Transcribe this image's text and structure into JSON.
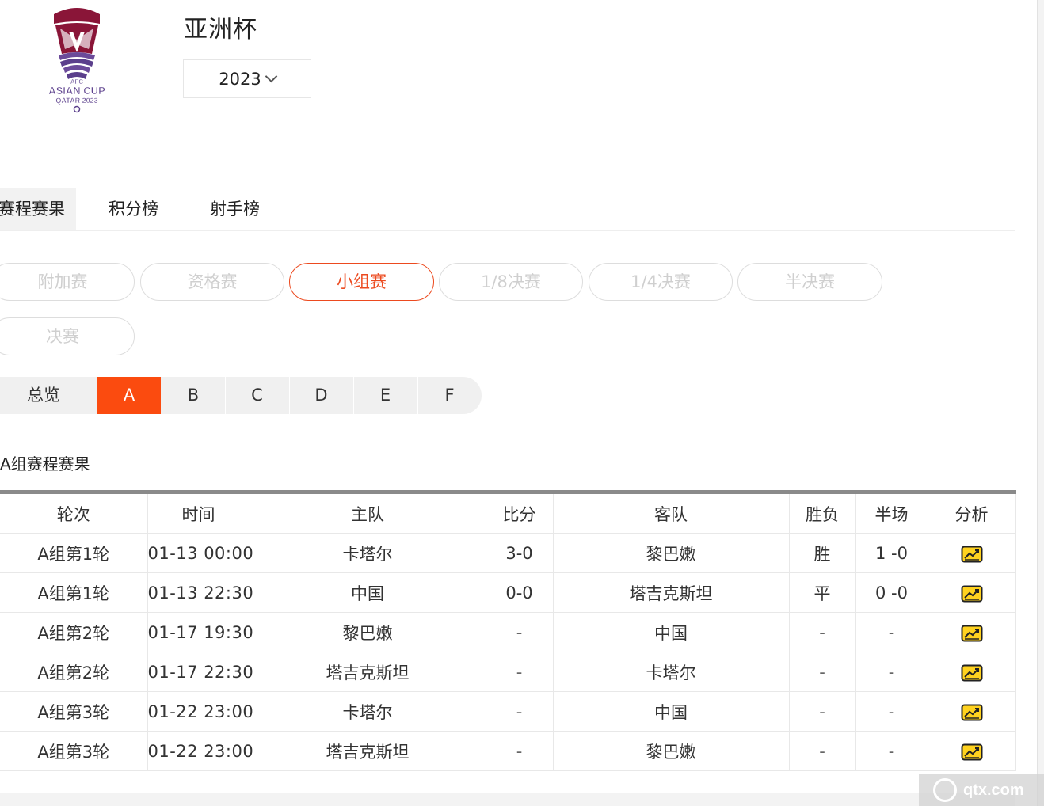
{
  "header": {
    "title": "亚洲杯",
    "season": "2023",
    "logo": {
      "line1": "AFC",
      "line2": "ASIAN CUP",
      "line3": "QATAR 2023",
      "colors": {
        "maroon": "#8a1538",
        "purple": "#5b3f8c",
        "white": "#ffffff"
      }
    }
  },
  "tabs": [
    "赛程赛果",
    "积分榜",
    "射手榜"
  ],
  "stages": [
    "附加赛",
    "资格赛",
    "小组赛",
    "1/8决赛",
    "1/4决赛",
    "半决赛",
    "决赛"
  ],
  "active_stage": "小组赛",
  "groups": [
    "总览",
    "A",
    "B",
    "C",
    "D",
    "E",
    "F"
  ],
  "active_group": "A",
  "section_title": "A组赛程赛果",
  "table": {
    "headers": [
      "轮次",
      "时间",
      "主队",
      "比分",
      "客队",
      "胜负",
      "半场",
      "分析"
    ],
    "rows": [
      {
        "round": "A组第1轮",
        "time": "01-13 00:00",
        "home": "卡塔尔",
        "score": "3-0",
        "away": "黎巴嫩",
        "result": "胜",
        "half": "1 -0"
      },
      {
        "round": "A组第1轮",
        "time": "01-13 22:30",
        "home": "中国",
        "score": "0-0",
        "away": "塔吉克斯坦",
        "result": "平",
        "half": "0 -0"
      },
      {
        "round": "A组第2轮",
        "time": "01-17 19:30",
        "home": "黎巴嫩",
        "score": "-",
        "away": "中国",
        "result": "-",
        "half": "-"
      },
      {
        "round": "A组第2轮",
        "time": "01-17 22:30",
        "home": "塔吉克斯坦",
        "score": "-",
        "away": "卡塔尔",
        "result": "-",
        "half": "-"
      },
      {
        "round": "A组第3轮",
        "time": "01-22 23:00",
        "home": "卡塔尔",
        "score": "-",
        "away": "中国",
        "result": "-",
        "half": "-"
      },
      {
        "round": "A组第3轮",
        "time": "01-22 23:00",
        "home": "塔吉克斯坦",
        "score": "-",
        "away": "黎巴嫩",
        "result": "-",
        "half": "-"
      }
    ],
    "analysis_icon": "chart-analysis-icon"
  },
  "watermark": "qtx.com",
  "colors": {
    "accent": "#fb4b0f",
    "accent_border": "#ec4a1f",
    "pill_inactive_text": "#cfcfcf",
    "icon_yellow": "#ffd21f"
  }
}
